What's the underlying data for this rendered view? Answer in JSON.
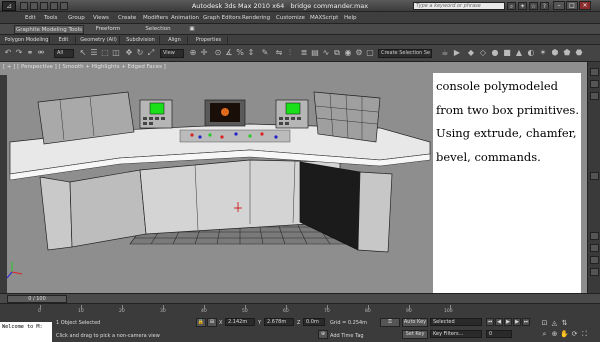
{
  "titlebar": {
    "app_title": "Autodesk 3ds Max  2010 x64",
    "file_name": "bridge commander.max",
    "search_placeholder": "Type a keyword or phrase"
  },
  "menu": [
    "Edit",
    "Tools",
    "Group",
    "Views",
    "Create",
    "Modifiers",
    "Animation",
    "Graph Editors",
    "Rendering",
    "Customize",
    "MAXScript",
    "Help"
  ],
  "ribbon": {
    "tabs": [
      "Graphite Modeling Tools",
      "Freeform",
      "Selection"
    ],
    "subtabs": [
      "Polygon Modeling",
      "Edit",
      "Geometry (All)",
      "Subdivision",
      "Align",
      "Properties"
    ]
  },
  "toolbar": {
    "filter_value": "All",
    "view_value": "View",
    "selection_set_placeholder": "Create Selection Se"
  },
  "viewport": {
    "label": "[ + ] [ Perspective ] [ Smooth + Highlights + Edged Faces ]"
  },
  "annotation": {
    "lines": [
      "console polymodeled",
      "from two box primitives.",
      "Using extrude, chamfer,",
      "bevel, commands."
    ]
  },
  "timeline": {
    "slider_label": "0 / 100",
    "ticks": [
      "0",
      "10",
      "20",
      "30",
      "40",
      "50",
      "60",
      "70",
      "80",
      "90",
      "100"
    ]
  },
  "status": {
    "listener_text": "Welcome to M:",
    "selected_count": "1 Object Selected",
    "prompt": "Click and drag to pick a non-camera view",
    "x_value": "2.142m",
    "y_value": "2.678m",
    "z_value": "0.0m",
    "grid": "Grid = 0.254m",
    "auto_key": "Auto Key",
    "set_key": "Set Key",
    "key_mode_value": "Selected",
    "key_filters": "Key Filters...",
    "add_time_tag": "Add Time Tag",
    "frame_value": "0"
  }
}
